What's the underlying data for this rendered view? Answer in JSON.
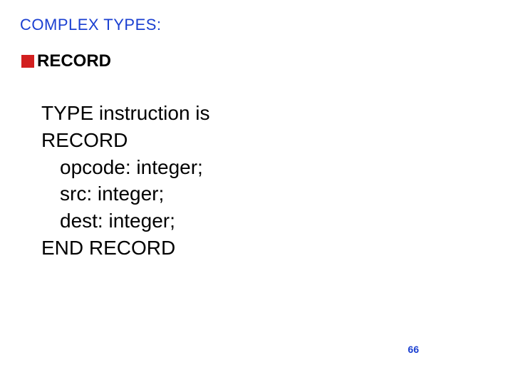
{
  "title": "COMPLEX TYPES:",
  "subheading": "RECORD",
  "body": {
    "line1": "TYPE instruction is",
    "line2": "RECORD",
    "field1": "opcode: integer;",
    "field2": "src: integer;",
    "field3": "dest: integer;",
    "line6": "END RECORD"
  },
  "page_number": "66"
}
